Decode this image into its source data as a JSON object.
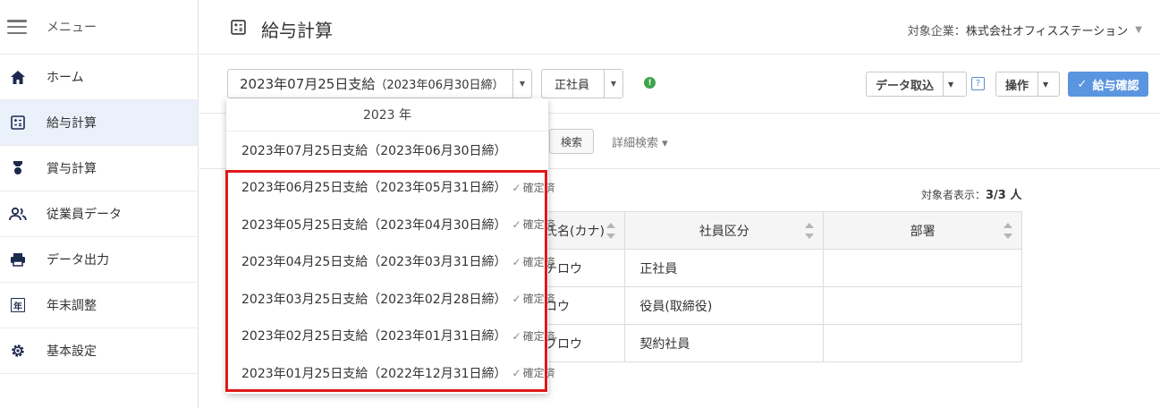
{
  "sidebar": {
    "menu_label": "メニュー",
    "items": [
      {
        "label": "ホーム",
        "icon": "home-icon"
      },
      {
        "label": "給与計算",
        "icon": "calculator-icon",
        "active": true
      },
      {
        "label": "賞与計算",
        "icon": "medal-icon"
      },
      {
        "label": "従業員データ",
        "icon": "users-icon"
      },
      {
        "label": "データ出力",
        "icon": "printer-icon"
      },
      {
        "label": "年末調整",
        "icon": "year-icon",
        "glyph": "年"
      },
      {
        "label": "基本設定",
        "icon": "gear-icon"
      }
    ]
  },
  "header": {
    "title": "給与計算",
    "company_label": "対象企業：",
    "company_name": "株式会社オフィスステーション"
  },
  "toolbar": {
    "period_main": "2023年07月25日支給",
    "period_sub": "（2023年06月30日締）",
    "employment_type": "正社員",
    "import_label": "データ取込",
    "help_label": "?",
    "operation_label": "操作",
    "confirm_label": "給与確認",
    "alert_glyph": "!"
  },
  "search": {
    "search_label": "検索",
    "detail_label": "詳細検索 ▾"
  },
  "count": {
    "label": "対象者表示：",
    "value": "3/3 人"
  },
  "table": {
    "headers": [
      "氏名(カナ)",
      "社員区分",
      "部署"
    ],
    "rows": [
      [
        "チロウ",
        "正社員",
        ""
      ],
      [
        "ロウ",
        "役員(取締役)",
        ""
      ],
      [
        "ブロウ",
        "契約社員",
        ""
      ]
    ]
  },
  "dropdown": {
    "year": "2023 年",
    "items": [
      {
        "label": "2023年07月25日支給（2023年06月30日締）",
        "status": ""
      },
      {
        "label": "2023年06月25日支給（2023年05月31日締）",
        "status": "確定済"
      },
      {
        "label": "2023年05月25日支給（2023年04月30日締）",
        "status": "確定済"
      },
      {
        "label": "2023年04月25日支給（2023年03月31日締）",
        "status": "確定済"
      },
      {
        "label": "2023年03月25日支給（2023年02月28日締）",
        "status": "確定済"
      },
      {
        "label": "2023年02月25日支給（2023年01月31日締）",
        "status": "確定済"
      },
      {
        "label": "2023年01月25日支給（2022年12月31日締）",
        "status": "確定済"
      }
    ]
  },
  "colors": {
    "accent": "#5b95e0",
    "highlight": "#e01919",
    "alert": "#3fa34d",
    "nav_icon": "#1d2a4e"
  }
}
